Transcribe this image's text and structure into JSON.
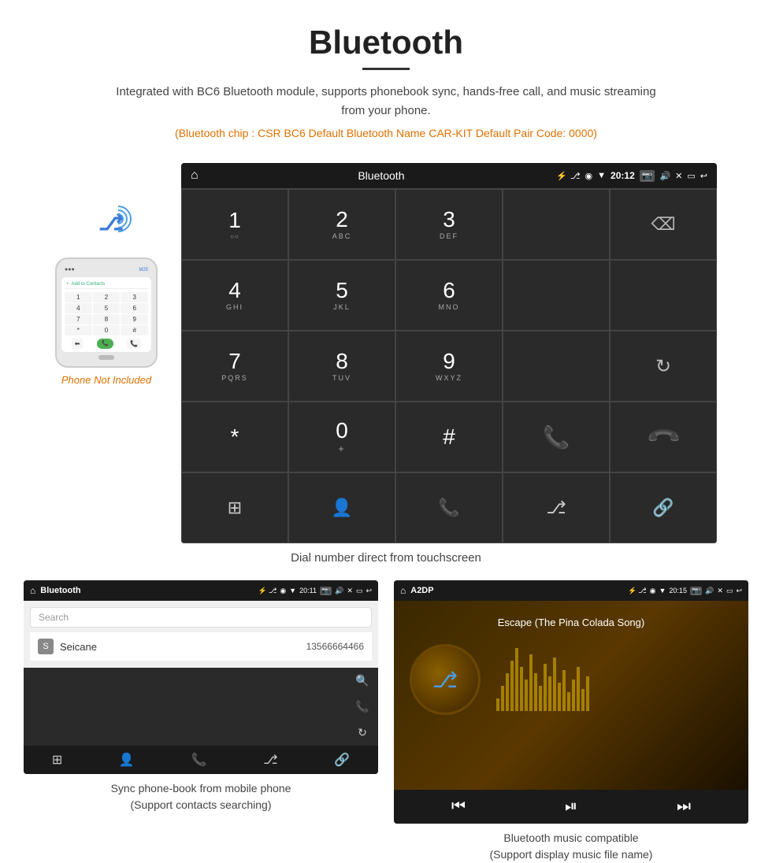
{
  "header": {
    "title": "Bluetooth",
    "description": "Integrated with BC6 Bluetooth module, supports phonebook sync, hands-free call, and music streaming from your phone.",
    "info_line": "(Bluetooth chip : CSR BC6    Default Bluetooth Name CAR-KIT    Default Pair Code: 0000)"
  },
  "dialer": {
    "status_bar": {
      "app_name": "Bluetooth",
      "time": "20:12"
    },
    "keys": [
      {
        "num": "1",
        "sub": ""
      },
      {
        "num": "2",
        "sub": "ABC"
      },
      {
        "num": "3",
        "sub": "DEF"
      },
      {
        "num": "4",
        "sub": "GHI"
      },
      {
        "num": "5",
        "sub": "JKL"
      },
      {
        "num": "6",
        "sub": "MNO"
      },
      {
        "num": "7",
        "sub": "PQRS"
      },
      {
        "num": "8",
        "sub": "TUV"
      },
      {
        "num": "9",
        "sub": "WXYZ"
      },
      {
        "num": "*",
        "sub": ""
      },
      {
        "num": "0",
        "sub": "+"
      },
      {
        "num": "#",
        "sub": ""
      }
    ],
    "caption": "Dial number direct from touchscreen"
  },
  "phone_illustration": {
    "not_included": "Phone Not Included"
  },
  "phonebook": {
    "status_bar": {
      "app_name": "Bluetooth",
      "time": "20:11"
    },
    "search_placeholder": "Search",
    "contact": {
      "letter": "S",
      "name": "Seicane",
      "number": "13566664466"
    },
    "caption_line1": "Sync phone-book from mobile phone",
    "caption_line2": "(Support contacts searching)"
  },
  "music": {
    "status_bar": {
      "app_name": "A2DP",
      "time": "20:15"
    },
    "song_title": "Escape (The Pina Colada Song)",
    "caption_line1": "Bluetooth music compatible",
    "caption_line2": "(Support display music file name)"
  }
}
